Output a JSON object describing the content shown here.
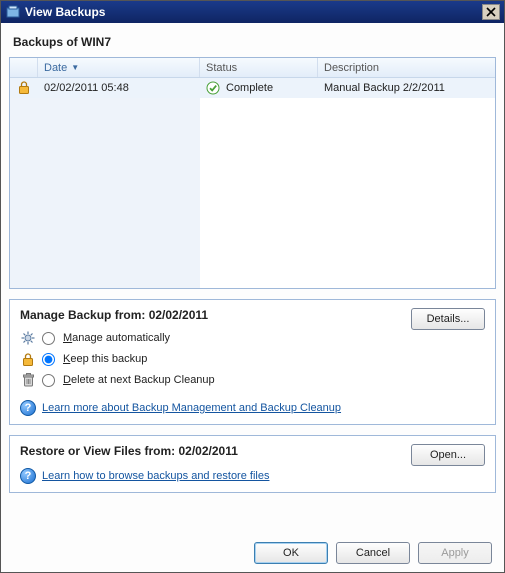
{
  "window": {
    "title": "View Backups"
  },
  "page": {
    "heading": "Backups of WIN7"
  },
  "grid": {
    "columns": {
      "date": "Date",
      "status": "Status",
      "description": "Description"
    },
    "rows": [
      {
        "locked": true,
        "date": "02/02/2011 05:48",
        "status": "Complete",
        "description": "Manual Backup 2/2/2011"
      }
    ]
  },
  "manage": {
    "title": "Manage Backup from: 02/02/2011",
    "details_label": "Details...",
    "options": {
      "auto": "Manage automatically",
      "keep": "Keep this backup",
      "delete": "Delete at next Backup Cleanup"
    },
    "selected": "keep",
    "learn_link": "Learn more about Backup Management and Backup Cleanup"
  },
  "restore": {
    "title": "Restore or View Files from: 02/02/2011",
    "open_label": "Open...",
    "learn_link": "Learn how to browse backups and restore files"
  },
  "buttons": {
    "ok": "OK",
    "cancel": "Cancel",
    "apply": "Apply"
  },
  "icons": {
    "lock": "lock-icon",
    "gear": "gear-icon",
    "trash": "trash-icon",
    "help": "help-icon",
    "check": "check-icon",
    "close": "close-icon",
    "app": "app-icon",
    "sort": "sort-desc-icon"
  }
}
